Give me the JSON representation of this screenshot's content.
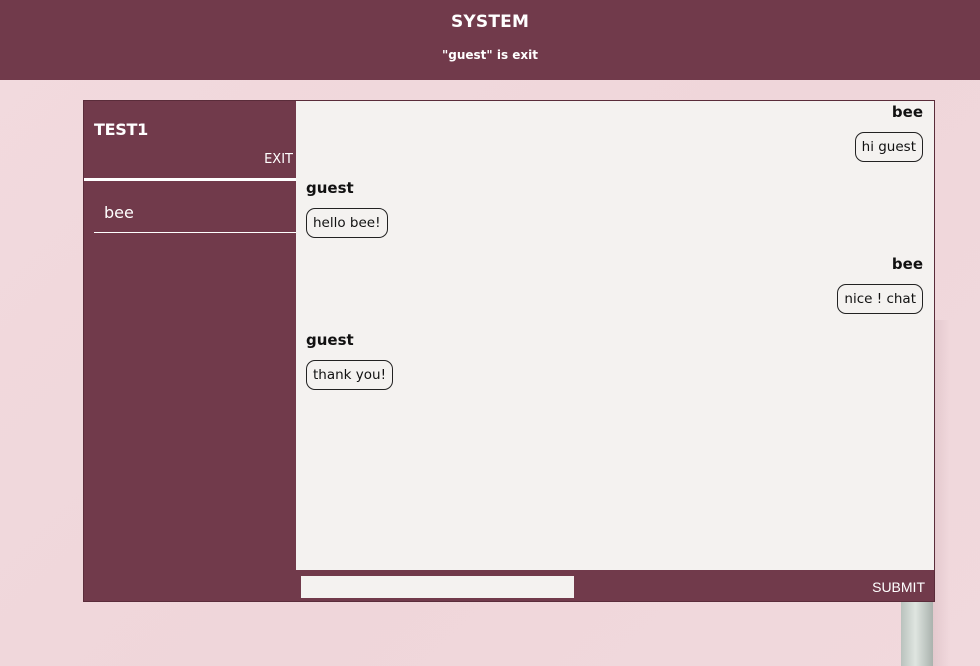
{
  "system": {
    "title": "SYSTEM",
    "message": "\"guest\" is exit"
  },
  "room": {
    "title": "TEST1",
    "exit_label": "EXIT"
  },
  "users": [
    {
      "name": "bee"
    }
  ],
  "messages": [
    {
      "sender": "bee",
      "text": "hi guest",
      "side": "right"
    },
    {
      "sender": "guest",
      "text": "hello bee!",
      "side": "left"
    },
    {
      "sender": "bee",
      "text": "nice ! chat",
      "side": "right"
    },
    {
      "sender": "guest",
      "text": "thank you!",
      "side": "left"
    }
  ],
  "composer": {
    "value": "",
    "submit_label": "SUBMIT"
  },
  "colors": {
    "primary": "#713a4b",
    "chat_background": "#f4f2f0",
    "page_background": "#f1d9dd"
  }
}
